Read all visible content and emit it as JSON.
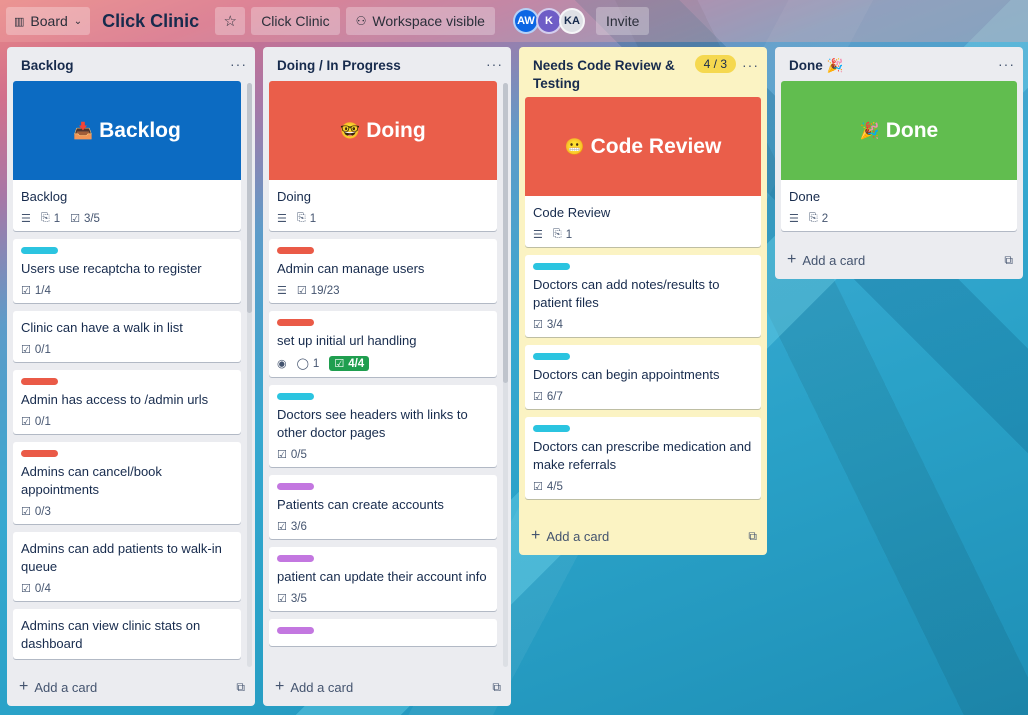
{
  "topbar": {
    "board_view": "Board",
    "title": "Click Clinic",
    "workspace": "Click Clinic",
    "visibility": "Workspace visible",
    "avatars": [
      {
        "initials": "AW",
        "color": "#0c66e4"
      },
      {
        "initials": "K",
        "color": "#6e5dc6"
      },
      {
        "initials": "KA",
        "color": "#dfe1e6"
      }
    ],
    "invite": "Invite"
  },
  "lists": [
    {
      "title": "Backlog",
      "cover": {
        "title": "Backlog",
        "text": "Backlog",
        "emoji": "📥",
        "color": "#0c6bc2",
        "attachments": "1",
        "checklist": "3/5"
      },
      "cards": [
        {
          "label": "#2bc4e0",
          "title": "Users use recaptcha to register",
          "checklist": "1/4"
        },
        {
          "label": "",
          "title": "Clinic can have a walk in list",
          "checklist": "0/1"
        },
        {
          "label": "#ea5a47",
          "title": "Admin has access to /admin urls",
          "checklist": "0/1"
        },
        {
          "label": "#ea5a47",
          "title": "Admins can cancel/book appointments",
          "checklist": "0/3"
        },
        {
          "label": "",
          "title": "Admins can add patients to walk-in queue",
          "checklist": "0/4"
        },
        {
          "label": "",
          "title": "Admins can view clinic stats on dashboard",
          "checklist": ""
        }
      ],
      "add": "Add a card"
    },
    {
      "title": "Doing / In Progress",
      "cover": {
        "title": "Doing",
        "text": "Doing",
        "emoji": "🤓",
        "color": "#ea5e4a",
        "attachments": "1",
        "checklist": ""
      },
      "cards": [
        {
          "label": "#ea5a47",
          "title": "Admin can manage users",
          "checklist": "19/23",
          "description": true
        },
        {
          "label": "#ea5a47",
          "title": "set up initial url handling",
          "comments": "1",
          "checklist_done": "4/4",
          "watch": true
        },
        {
          "label": "#2bc4e0",
          "title": "Doctors see headers with links to other doctor pages",
          "checklist": "0/5"
        },
        {
          "label": "#c377e0",
          "title": "Patients can create accounts",
          "checklist": "3/6"
        },
        {
          "label": "#c377e0",
          "title": "patient can update their account info",
          "checklist": "3/5"
        },
        {
          "label": "#c377e0",
          "title": "",
          "checklist": ""
        }
      ],
      "add": "Add a card"
    },
    {
      "title": "Needs Code Review & Testing",
      "wip": "4 / 3",
      "cover": {
        "title": "Code Review",
        "text": "Code Review",
        "emoji": "😬",
        "color": "#ea5e4a",
        "attachments": "1",
        "checklist": ""
      },
      "cards": [
        {
          "label": "#2bc4e0",
          "title": "Doctors can add notes/results to patient files",
          "checklist": "3/4"
        },
        {
          "label": "#2bc4e0",
          "title": "Doctors can begin appointments",
          "checklist": "6/7"
        },
        {
          "label": "#2bc4e0",
          "title": "Doctors can prescribe medication and make referrals",
          "checklist": "4/5"
        }
      ],
      "add": "Add a card"
    },
    {
      "title": "Done 🎉",
      "cover": {
        "title": "Done",
        "text": "Done",
        "emoji": "🎉",
        "color": "#61bd4f",
        "attachments": "2",
        "checklist": ""
      },
      "cards": [],
      "add": "Add a card"
    }
  ]
}
